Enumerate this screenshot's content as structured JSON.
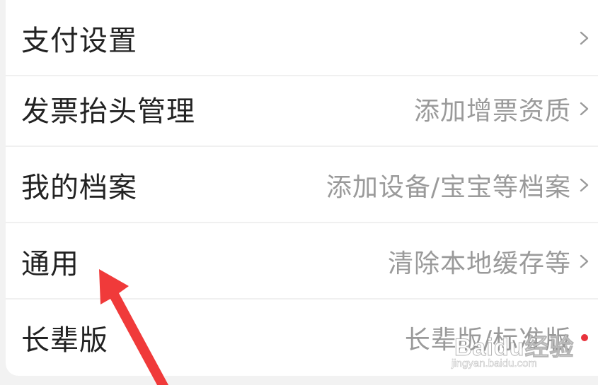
{
  "settings": {
    "rows": [
      {
        "label": "支付设置",
        "value": "",
        "indicator": "chevron"
      },
      {
        "label": "发票抬头管理",
        "value": "添加增票资质",
        "indicator": "chevron"
      },
      {
        "label": "我的档案",
        "value": "添加设备/宝宝等档案",
        "indicator": "chevron"
      },
      {
        "label": "通用",
        "value": "清除本地缓存等",
        "indicator": "chevron"
      },
      {
        "label": "长辈版",
        "value": "长辈版/标准版",
        "indicator": "red-dot"
      }
    ]
  },
  "annotation": {
    "arrow_color": "#f03a3a"
  },
  "watermark": {
    "logo_text": "Baidu经验",
    "url": "jingyan.baidu.com"
  },
  "colors": {
    "label": "#222222",
    "value": "#9a9a9a",
    "red_dot": "#e8323c",
    "background": "#f2f2f2",
    "card": "#ffffff"
  }
}
